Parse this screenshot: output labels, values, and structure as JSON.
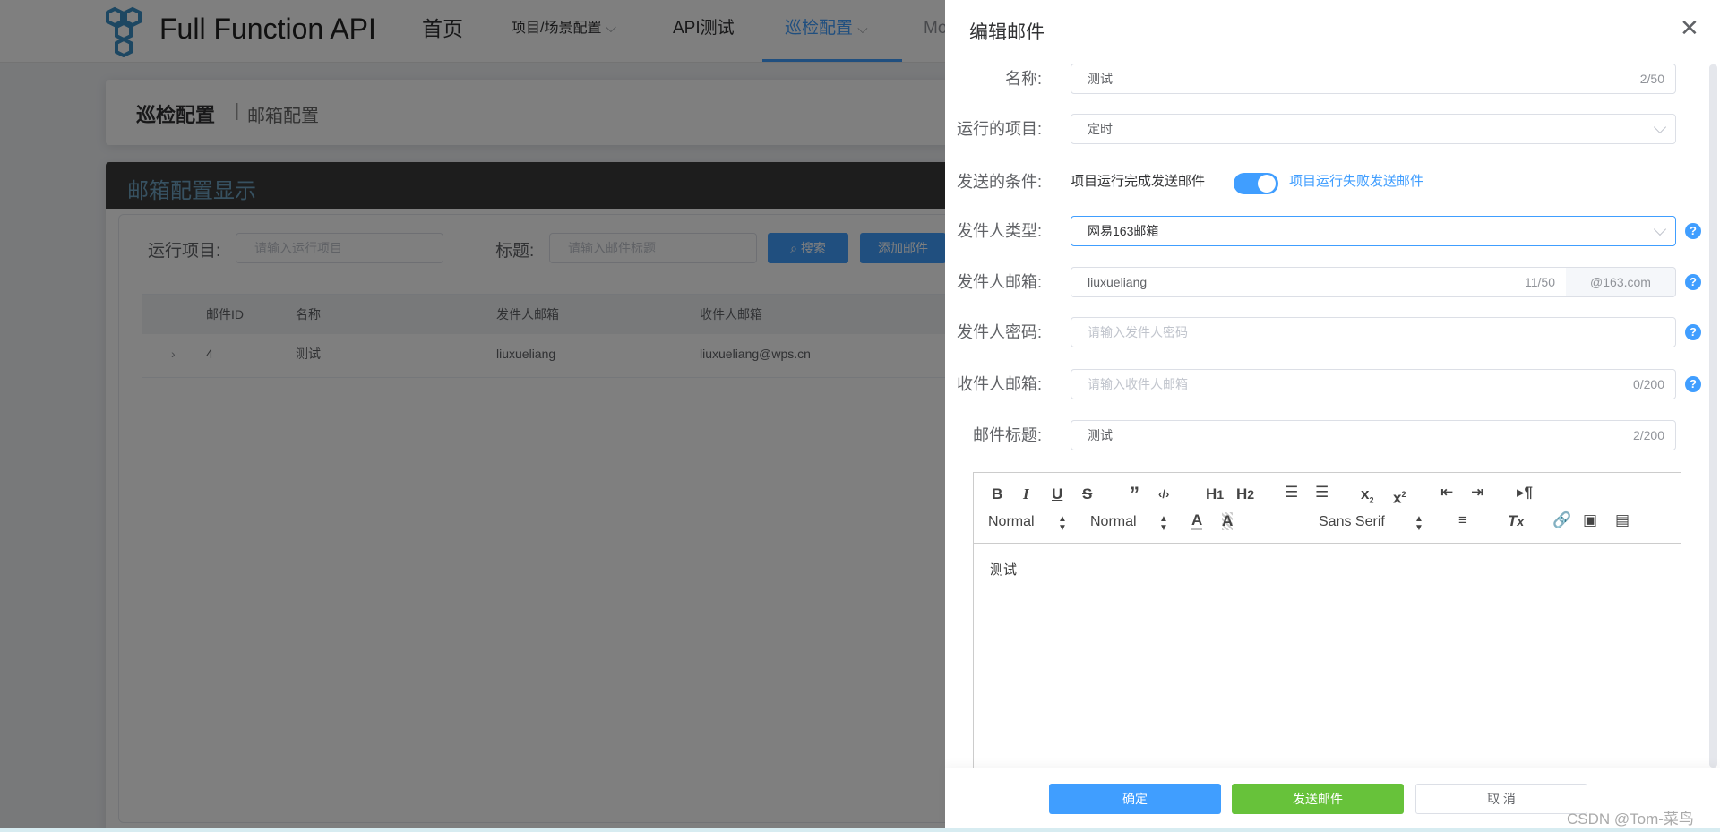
{
  "nav": {
    "brand": "Full Function API",
    "items": [
      {
        "label": "首页"
      },
      {
        "label": "项目/场景配置"
      },
      {
        "label": "API测试"
      },
      {
        "label": "巡检配置",
        "active": true
      },
      {
        "label": "Mo"
      }
    ],
    "accent": "#409eff"
  },
  "breadcrumb": {
    "current": "巡检配置",
    "sep": "|",
    "sub": "邮箱配置"
  },
  "panel": {
    "title": "邮箱配置显示",
    "filters": {
      "project_label": "运行项目:",
      "project_placeholder": "请输入运行项目",
      "title_label": "标题:",
      "title_placeholder": "请输入邮件标题",
      "search_btn": "搜索",
      "add_btn": "添加邮件"
    },
    "table": {
      "columns": [
        "邮件ID",
        "名称",
        "发件人邮箱",
        "收件人邮箱"
      ],
      "rows": [
        {
          "id": "4",
          "name": "测试",
          "sender": "liuxueliang",
          "receiver": "liuxueliang@wps.cn"
        }
      ]
    }
  },
  "drawer": {
    "title": "编辑邮件",
    "fields": {
      "name": {
        "label": "名称:",
        "value": "测试",
        "count": "2/50"
      },
      "project": {
        "label": "运行的项目:",
        "value": "定时"
      },
      "condition": {
        "label": "发送的条件:",
        "off_text": "项目运行完成发送邮件",
        "on_text": "项目运行失败发送邮件",
        "toggle_on": true
      },
      "sender_type": {
        "label": "发件人类型:",
        "value": "网易163邮箱"
      },
      "sender_email": {
        "label": "发件人邮箱:",
        "value": "liuxueliang",
        "count": "11/50",
        "suffix": "@163.com"
      },
      "sender_password": {
        "label": "发件人密码:",
        "placeholder": "请输入发件人密码"
      },
      "receiver_email": {
        "label": "收件人邮箱:",
        "placeholder": "请输入收件人邮箱",
        "count": "0/200"
      },
      "subject": {
        "label": "邮件标题:",
        "value": "测试",
        "count": "2/200"
      }
    },
    "editor": {
      "header_select": "Normal",
      "size_select": "Normal",
      "font_select": "Sans Serif",
      "content": "测试"
    },
    "buttons": {
      "confirm": "确定",
      "send": "发送邮件",
      "cancel": "取 消"
    },
    "colors": {
      "confirm": "#409eff",
      "send": "#67c23a"
    }
  },
  "watermark": "CSDN @Tom-菜鸟"
}
